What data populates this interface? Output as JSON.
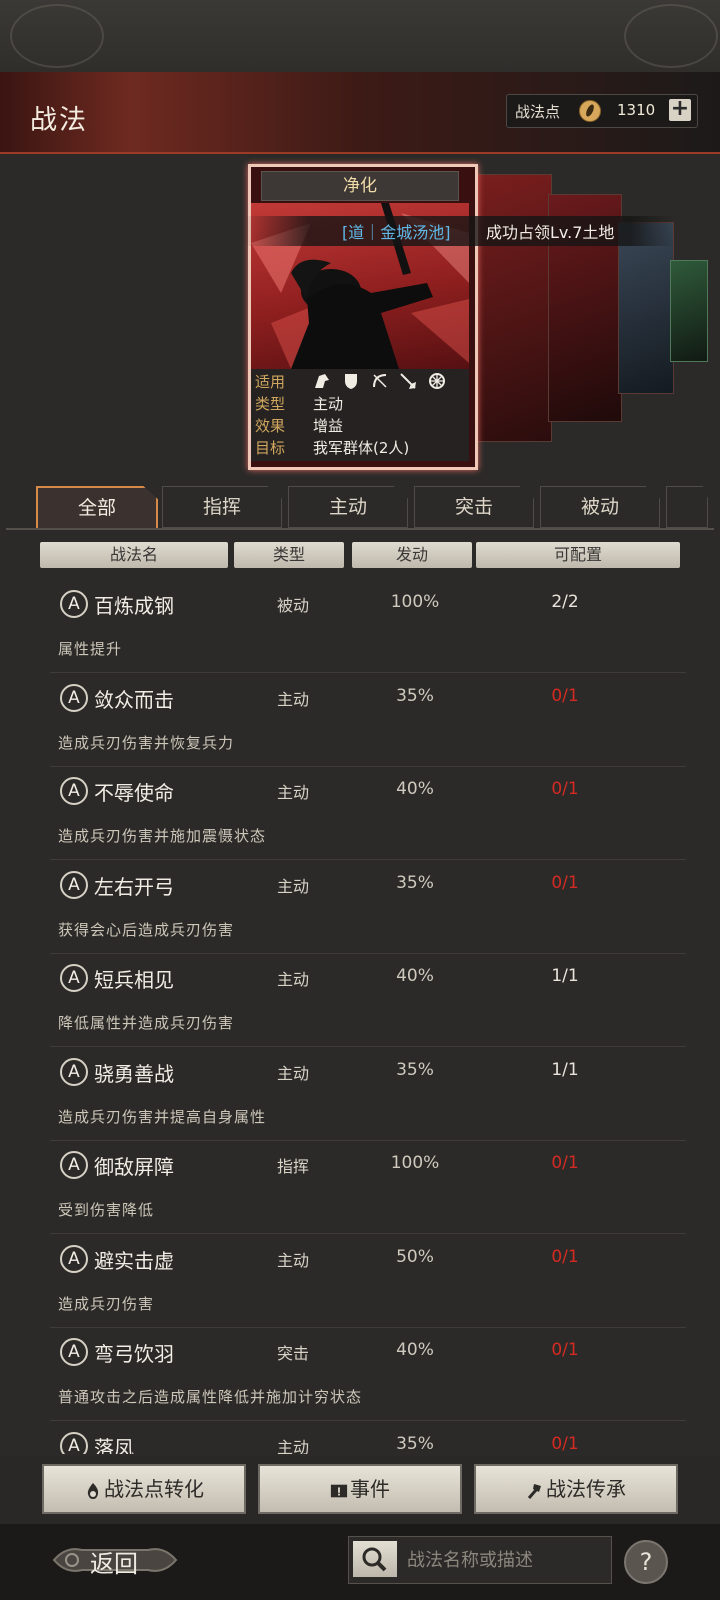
{
  "header": {
    "title": "战法",
    "points_label": "战法点",
    "points_value": "1310",
    "add_label": "+"
  },
  "card": {
    "name": "净化",
    "banner": {
      "tag": "[道｜金城汤池]",
      "text": "成功占领Lv.7土地"
    },
    "info": [
      {
        "key": "适用",
        "value": ""
      },
      {
        "key": "类型",
        "value": "主动"
      },
      {
        "key": "效果",
        "value": "增益"
      },
      {
        "key": "目标",
        "value": "我军群体(2人)"
      }
    ],
    "unit_icons": [
      "cavalry-icon",
      "shield-icon",
      "bow-icon",
      "spear-icon",
      "wheel-icon"
    ]
  },
  "tabs": [
    "全部",
    "指挥",
    "主动",
    "突击",
    "被动"
  ],
  "table": {
    "headers": [
      "战法名",
      "类型",
      "发动",
      "可配置"
    ],
    "rows": [
      {
        "grade": "A",
        "name": "百炼成钢",
        "type": "被动",
        "rate": "100%",
        "cfg": "2/2",
        "cfg_red": false,
        "desc": "属性提升"
      },
      {
        "grade": "A",
        "name": "敛众而击",
        "type": "主动",
        "rate": "35%",
        "cfg": "0/1",
        "cfg_red": true,
        "desc": "造成兵刃伤害并恢复兵力"
      },
      {
        "grade": "A",
        "name": "不辱使命",
        "type": "主动",
        "rate": "40%",
        "cfg": "0/1",
        "cfg_red": true,
        "desc": "造成兵刃伤害并施加震慑状态"
      },
      {
        "grade": "A",
        "name": "左右开弓",
        "type": "主动",
        "rate": "35%",
        "cfg": "0/1",
        "cfg_red": true,
        "desc": "获得会心后造成兵刃伤害"
      },
      {
        "grade": "A",
        "name": "短兵相见",
        "type": "主动",
        "rate": "40%",
        "cfg": "1/1",
        "cfg_red": false,
        "desc": "降低属性并造成兵刃伤害"
      },
      {
        "grade": "A",
        "name": "骁勇善战",
        "type": "主动",
        "rate": "35%",
        "cfg": "1/1",
        "cfg_red": false,
        "desc": "造成兵刃伤害并提高自身属性"
      },
      {
        "grade": "A",
        "name": "御敌屏障",
        "type": "指挥",
        "rate": "100%",
        "cfg": "0/1",
        "cfg_red": true,
        "desc": "受到伤害降低"
      },
      {
        "grade": "A",
        "name": "避实击虚",
        "type": "主动",
        "rate": "50%",
        "cfg": "0/1",
        "cfg_red": true,
        "desc": "造成兵刃伤害"
      },
      {
        "grade": "A",
        "name": "弯弓饮羽",
        "type": "突击",
        "rate": "40%",
        "cfg": "0/1",
        "cfg_red": true,
        "desc": "普通攻击之后造成属性降低并施加计穷状态"
      },
      {
        "grade": "A",
        "name": "落凤",
        "type": "主动",
        "rate": "35%",
        "cfg": "0/1",
        "cfg_red": true,
        "desc": ""
      }
    ]
  },
  "buttons": {
    "convert": "战法点转化",
    "events": "事件",
    "inherit": "战法传承"
  },
  "footer": {
    "back": "返回",
    "search_placeholder": "战法名称或描述",
    "help": "?"
  },
  "colors": {
    "accent_red": "#d42a22",
    "tab_active_border": "#d58a4a",
    "banner_tag": "#5fb8e6"
  }
}
